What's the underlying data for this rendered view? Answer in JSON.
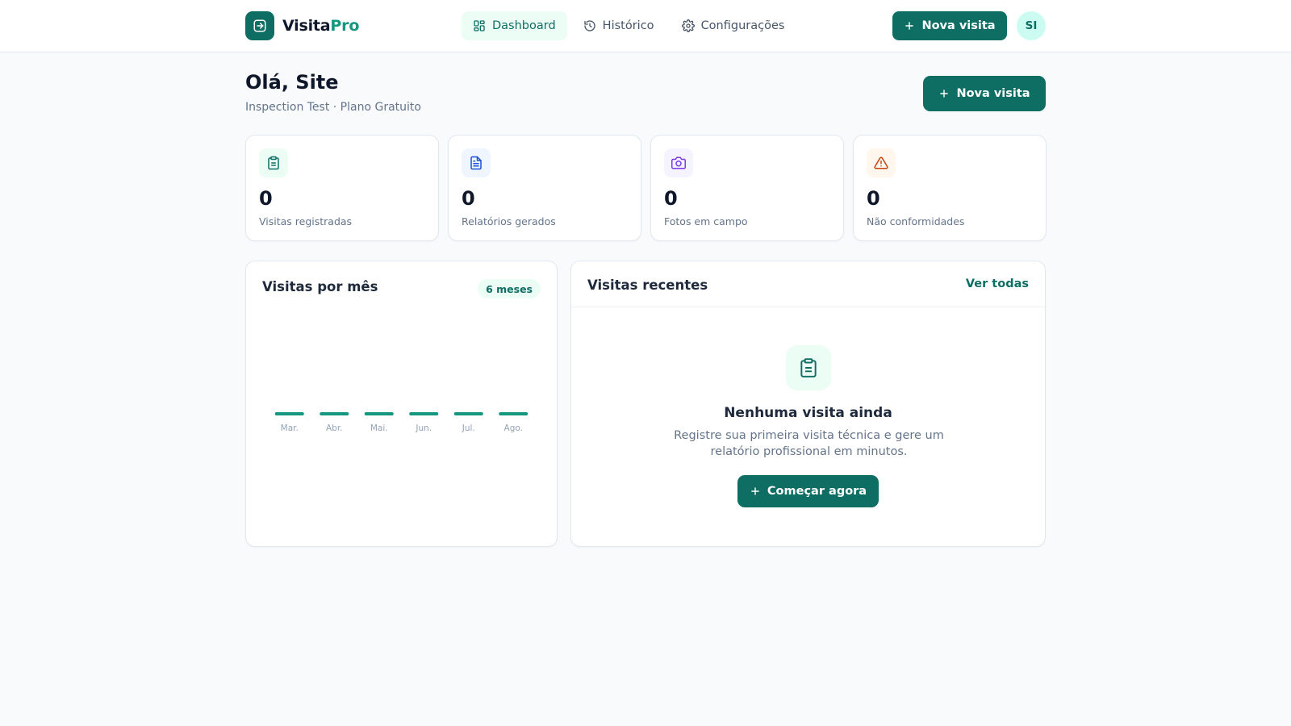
{
  "app": {
    "brand_main": "Visita",
    "brand_accent": "Pro"
  },
  "nav": {
    "items": [
      {
        "label": "Dashboard",
        "icon": "dashboard-icon",
        "active": true
      },
      {
        "label": "Histórico",
        "icon": "history-icon",
        "active": false
      },
      {
        "label": "Configurações",
        "icon": "gear-icon",
        "active": false
      }
    ]
  },
  "header": {
    "new_visit_label": "Nova visita",
    "avatar_initials": "SI"
  },
  "greeting": {
    "title": "Olá, Site",
    "subtitle": "Inspection Test · Plano Gratuito",
    "new_visit_label": "Nova visita"
  },
  "stats": [
    {
      "value": "0",
      "label": "Visitas registradas",
      "icon": "clipboard-icon",
      "color": "#0f6e64",
      "bg": "#ecfdf5"
    },
    {
      "value": "0",
      "label": "Relatórios gerados",
      "icon": "document-icon",
      "color": "#1d4ed8",
      "bg": "#eff6ff"
    },
    {
      "value": "0",
      "label": "Fotos em campo",
      "icon": "camera-icon",
      "color": "#7c3aed",
      "bg": "#f5f3ff"
    },
    {
      "value": "0",
      "label": "Não conformidades",
      "icon": "warning-icon",
      "color": "#c2410c",
      "bg": "#fff7ed"
    }
  ],
  "chart_panel": {
    "title": "Visitas por mês",
    "range_badge": "6 meses"
  },
  "chart_data": {
    "type": "bar",
    "categories": [
      "Mar.",
      "Abr.",
      "Mai.",
      "Jun.",
      "Jul.",
      "Ago."
    ],
    "values": [
      0,
      0,
      0,
      0,
      0,
      0
    ],
    "title": "Visitas por mês",
    "xlabel": "",
    "ylabel": "",
    "bar_color": "#14967f"
  },
  "recent": {
    "title": "Visitas recentes",
    "view_all": "Ver todas",
    "empty_title": "Nenhuma visita ainda",
    "empty_desc": "Registre sua primeira visita técnica e gere um relatório profissional em minutos.",
    "cta_label": "Começar agora"
  },
  "colors": {
    "primary": "#0f6e64",
    "accent": "#14967f",
    "background": "#f8fafc"
  }
}
